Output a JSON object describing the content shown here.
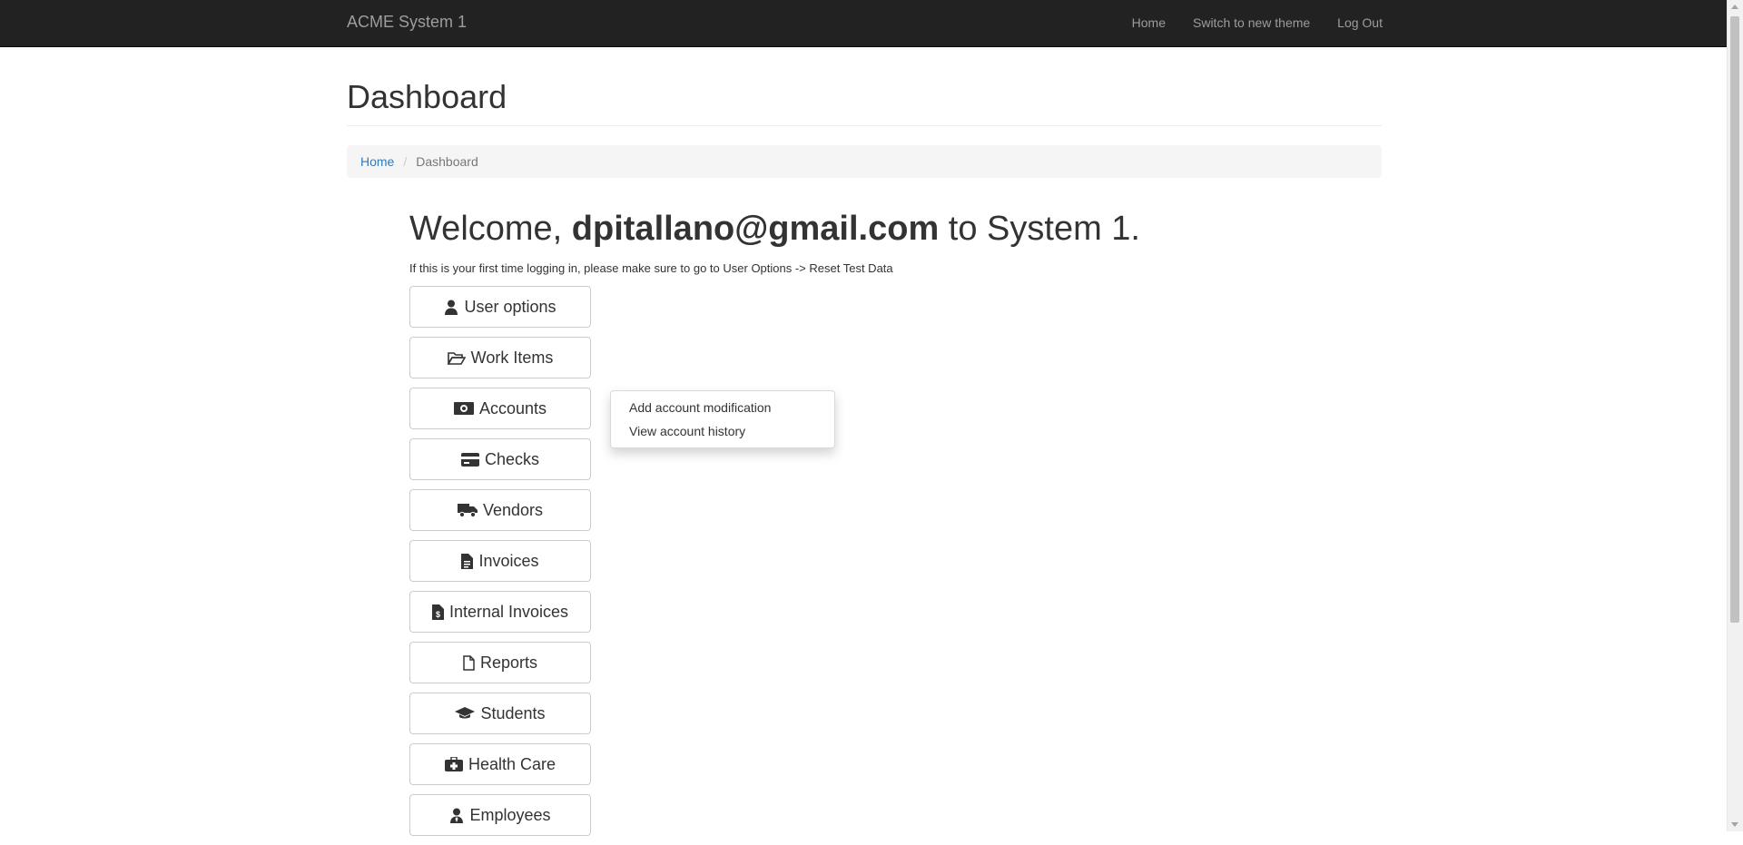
{
  "navbar": {
    "brand": "ACME System 1",
    "links": [
      "Home",
      "Switch to new theme",
      "Log Out"
    ]
  },
  "page": {
    "title": "Dashboard",
    "breadcrumb": {
      "home": "Home",
      "current": "Dashboard"
    }
  },
  "welcome": {
    "prefix": "Welcome, ",
    "email": "dpitallano@gmail.com",
    "suffix": " to System 1.",
    "notice": "If this is your first time logging in, please make sure to go to User Options -> Reset Test Data"
  },
  "menu": [
    {
      "label": "User options",
      "icon": "user-icon"
    },
    {
      "label": "Work Items",
      "icon": "folder-open-icon"
    },
    {
      "label": "Accounts",
      "icon": "money-icon"
    },
    {
      "label": "Checks",
      "icon": "credit-card-icon"
    },
    {
      "label": "Vendors",
      "icon": "truck-icon"
    },
    {
      "label": "Invoices",
      "icon": "file-text-icon"
    },
    {
      "label": "Internal Invoices",
      "icon": "file-invoice-dollar-icon"
    },
    {
      "label": "Reports",
      "icon": "file-icon"
    },
    {
      "label": "Students",
      "icon": "graduation-cap-icon"
    },
    {
      "label": "Health Care",
      "icon": "medkit-icon"
    },
    {
      "label": "Employees",
      "icon": "user-tie-icon"
    }
  ],
  "accounts_dropdown": {
    "items": [
      "Add account modification",
      "View account history"
    ]
  }
}
